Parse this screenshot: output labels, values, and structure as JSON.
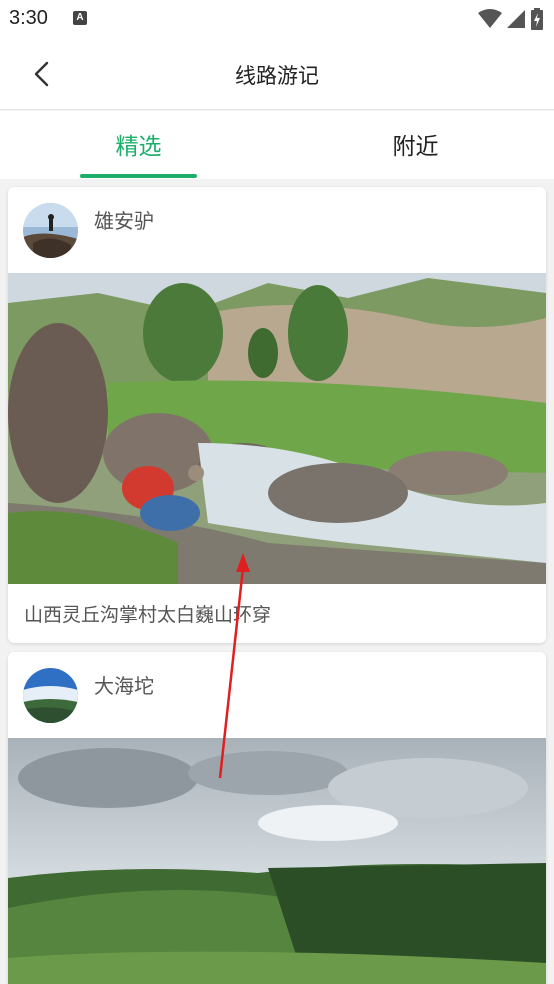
{
  "status_bar": {
    "time": "3:30",
    "notification_icon": "a-notification-icon",
    "icons": [
      "wifi-icon",
      "signal-icon",
      "battery-charging-icon"
    ]
  },
  "header": {
    "back_icon": "back-arrow-icon",
    "title": "线路游记"
  },
  "tabs": [
    {
      "label": "精选",
      "active": true
    },
    {
      "label": "附近",
      "active": false
    }
  ],
  "colors": {
    "accent": "#1dae6a",
    "annotation_arrow": "#e02020"
  },
  "feed": [
    {
      "author": "雄安驴",
      "title": "山西灵丘沟掌村太白巍山环穿"
    },
    {
      "author": "大海坨",
      "title": ""
    }
  ]
}
